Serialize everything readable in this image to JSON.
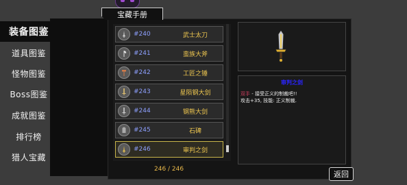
{
  "header": {
    "title": "宝藏手册"
  },
  "sidebar": {
    "items": [
      {
        "label": "装备图鉴",
        "active": true
      },
      {
        "label": "道具图鉴"
      },
      {
        "label": "怪物图鉴"
      },
      {
        "label": "Boss图鉴"
      },
      {
        "label": "成就图鉴"
      },
      {
        "label": "排行榜"
      },
      {
        "label": "猎人宝藏"
      }
    ]
  },
  "list": {
    "items": [
      {
        "num": "#240",
        "name": "武士太刀",
        "icon": "sword-icon"
      },
      {
        "num": "#241",
        "name": "蛮族大斧",
        "icon": "axe-icon"
      },
      {
        "num": "#242",
        "name": "工匠之锤",
        "icon": "hammer-icon"
      },
      {
        "num": "#243",
        "name": "星陨钢大剑",
        "icon": "greatsword-icon"
      },
      {
        "num": "#244",
        "name": "钢熊大剑",
        "icon": "greatsword-icon"
      },
      {
        "num": "#245",
        "name": "石碑",
        "icon": "tablet-icon"
      },
      {
        "num": "#246",
        "name": "审判之剑",
        "icon": "sword-icon",
        "selected": true
      }
    ],
    "count": "246 / 246"
  },
  "detail": {
    "name": "审判之剑",
    "tag": "双手",
    "line1": " - 接受正义的制裁吧!!",
    "line2": "攻击+35, 技能: 正义制裁."
  },
  "back_label": "返回",
  "colors": {
    "accent": "#f0c850",
    "number": "#8ea0ff",
    "title": "#2a24ff"
  }
}
